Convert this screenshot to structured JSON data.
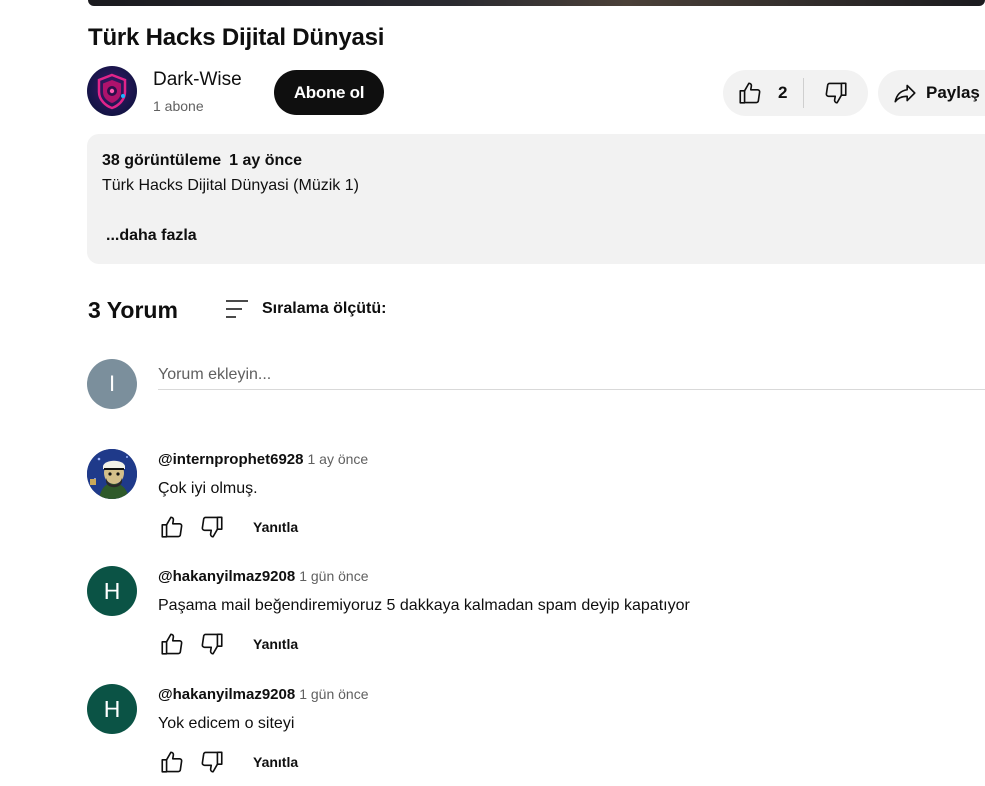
{
  "video": {
    "title": "Türk Hacks Dijital Dünyasi"
  },
  "channel": {
    "name": "Dark-Wise",
    "subscribers": "1 abone",
    "subscribe_label": "Abone ol"
  },
  "actions": {
    "like_count": "2",
    "share_label": "Paylaş"
  },
  "description": {
    "views": "38 görüntüleme",
    "date": "1 ay önce",
    "text": "Türk Hacks Dijital Dünyasi (Müzik 1)",
    "more_label": "...daha fazla"
  },
  "comments_section": {
    "count_label": "3 Yorum",
    "sort_label": "Sıralama ölçütü:",
    "me_initial": "I",
    "input_placeholder": "Yorum ekleyin...",
    "reply_label": "Yanıtla",
    "comments": [
      {
        "author": "@internprophet6928",
        "time": "1 ay önce",
        "text": "Çok iyi olmuş.",
        "avatar": "image"
      },
      {
        "author": "@hakanyilmaz9208",
        "time": "1 gün önce",
        "text": "Paşama mail beğendiremiyoruz 5 dakkaya kalmadan spam deyip kapatıyor",
        "avatar_initial": "H"
      },
      {
        "author": "@hakanyilmaz9208",
        "time": "1 gün önce",
        "text": "Yok edicem o siteyi",
        "avatar_initial": "H"
      }
    ]
  },
  "icons": [
    "thumbs-up-icon",
    "thumbs-down-icon",
    "share-icon",
    "sort-icon"
  ]
}
